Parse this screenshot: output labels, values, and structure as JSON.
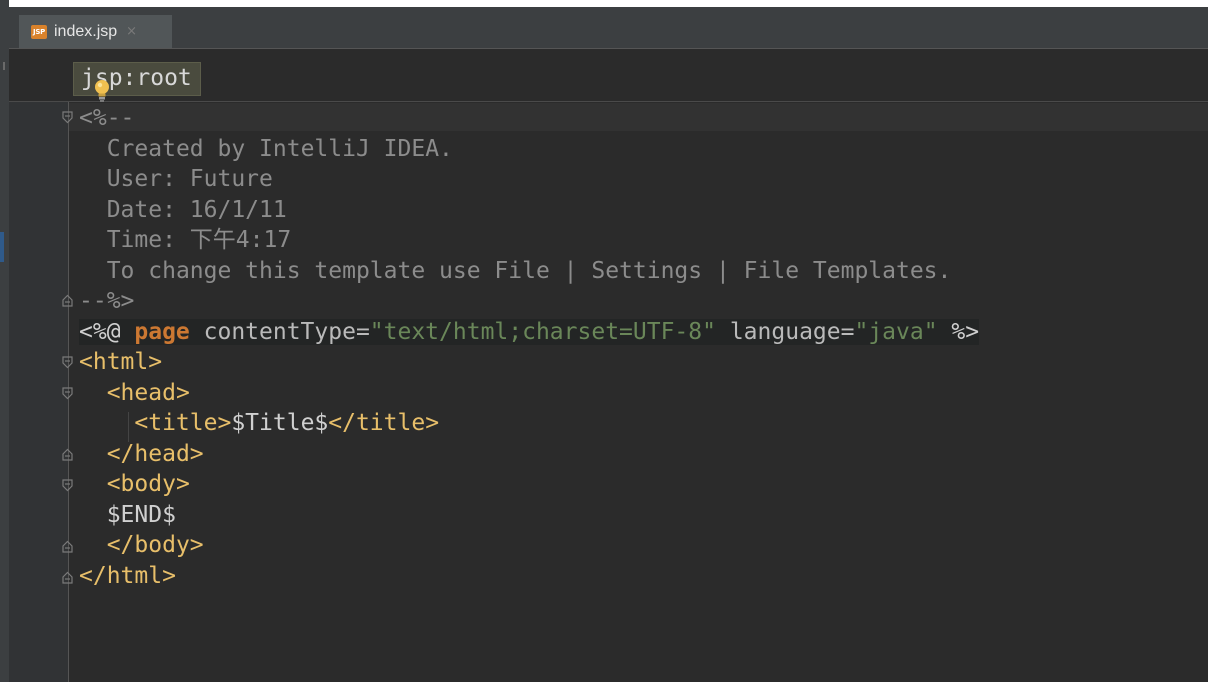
{
  "tab": {
    "icon_label": "JSP",
    "filename": "index.jsp",
    "close_glyph": "×"
  },
  "breadcrumb": {
    "text": "jsp:root"
  },
  "code": {
    "comment_open": "<%--",
    "comment_lines": [
      "Created by IntelliJ IDEA.",
      "User: Future",
      "Date: 16/1/11",
      "Time: 下午4:17",
      "To change this template use File | Settings | File Templates."
    ],
    "comment_close": "--%>",
    "directive": {
      "open": "<%@ ",
      "keyword": "page",
      "attr1_name": " contentType=",
      "attr1_value": "\"text/html;charset=UTF-8\"",
      "attr2_name": " language=",
      "attr2_value": "\"java\"",
      "close": " %>"
    },
    "html_open": "<html>",
    "head_open": "<head>",
    "title_open": "<title>",
    "title_text": "$Title$",
    "title_close": "</title>",
    "head_close": "</head>",
    "body_open": "<body>",
    "body_content": "$END$",
    "body_close": "</body>",
    "html_close": "</html>"
  },
  "icons": {
    "file_type": "jsp-file-icon",
    "intention": "lightbulb-icon",
    "fold_open": "fold-open-icon",
    "fold_close": "fold-close-icon"
  },
  "colors": {
    "background": "#2b2b2b",
    "gutter": "#313335",
    "keyword": "#cc7832",
    "string": "#6a8759",
    "tag": "#e8bf6a",
    "comment": "#8c8c8c"
  }
}
